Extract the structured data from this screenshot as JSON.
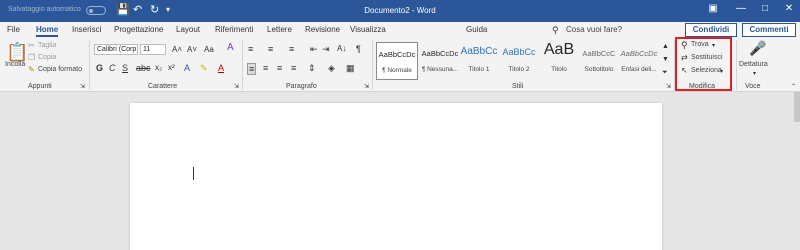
{
  "titlebar": {
    "autosave_label": "Salvataggio automatico",
    "document_title": "Documento2 - Word"
  },
  "tabs": [
    "File",
    "Home",
    "Inserisci",
    "Progettazione",
    "Layout",
    "Riferimenti",
    "Lettere",
    "Revisione",
    "Visualizza",
    "Guida"
  ],
  "tell_me": "Cosa vuoi fare?",
  "share_label": "Condividi",
  "comments_label": "Commenti",
  "clipboard": {
    "paste": "Incolla",
    "cut": "Taglia",
    "copy": "Copia",
    "format_painter": "Copia formato",
    "group": "Appunti"
  },
  "font": {
    "name": "Calibri (Corp",
    "size": "11",
    "group": "Carattere"
  },
  "paragraph": {
    "group": "Paragrafo"
  },
  "styles": {
    "group": "Stili",
    "items": [
      {
        "preview": "AaBbCcDc",
        "name": "¶ Normale"
      },
      {
        "preview": "AaBbCcDc",
        "name": "¶ Nessuna..."
      },
      {
        "preview": "AaBbCc",
        "name": "Titolo 1"
      },
      {
        "preview": "AaBbCc",
        "name": "Titolo 2"
      },
      {
        "preview": "AaB",
        "name": "Titolo"
      },
      {
        "preview": "AaBbCcC",
        "name": "Sottotitolo"
      },
      {
        "preview": "AaBbCcDc",
        "name": "Enfasi deli..."
      }
    ]
  },
  "editing": {
    "find": "Trova",
    "replace": "Sostituisci",
    "select": "Seleziona",
    "group": "Modifica"
  },
  "voice": {
    "dictate": "Dettatura",
    "group": "Voce"
  }
}
